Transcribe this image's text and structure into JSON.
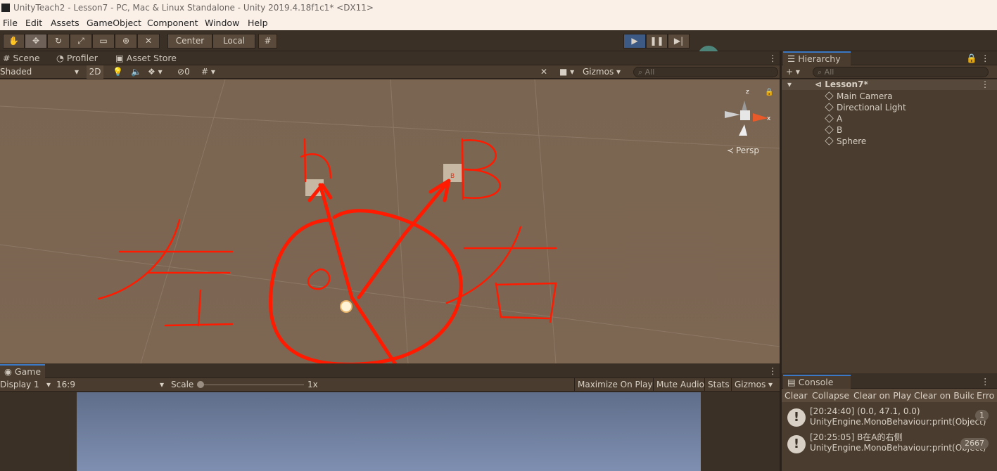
{
  "window": {
    "title": "UnityTeach2 - Lesson7 - PC, Mac & Linux Standalone - Unity 2019.4.18f1c1* <DX11>"
  },
  "menu": [
    "File",
    "Edit",
    "Assets",
    "GameObject",
    "Component",
    "Window",
    "Help"
  ],
  "toolbar": {
    "center_label": "Center",
    "local_label": "Local"
  },
  "scene": {
    "tabs": [
      "Scene",
      "Profiler",
      "Asset Store"
    ],
    "shading": "Shaded",
    "mode_2d": "2D",
    "fx_count": "0",
    "gizmos": "Gizmos",
    "search_placeholder": "All",
    "persp_label": "Persp",
    "axis_x": "x",
    "axis_z": "z",
    "object_b_label": "B"
  },
  "game": {
    "tab": "Game",
    "display": "Display 1",
    "aspect": "16:9",
    "scale_label": "Scale",
    "scale_value": "1x",
    "maximize": "Maximize On Play",
    "mute": "Mute Audio",
    "stats": "Stats",
    "gizmos": "Gizmos"
  },
  "hierarchy": {
    "tab": "Hierarchy",
    "search_placeholder": "All",
    "scene_name": "Lesson7*",
    "items": [
      "Main Camera",
      "Directional Light",
      "A",
      "B",
      "Sphere"
    ]
  },
  "console": {
    "tab": "Console",
    "buttons": [
      "Clear",
      "Collapse",
      "Clear on Play",
      "Clear on Build",
      "Erro"
    ],
    "logs": [
      {
        "line1": "[20:24:40] (0.0, 47.1, 0.0)",
        "line2": "UnityEngine.MonoBehaviour:print(Object)",
        "count": "1"
      },
      {
        "line1": "[20:25:05] B在A的右侧",
        "line2": "UnityEngine.MonoBehaviour:print(Object)",
        "count": "2667"
      }
    ]
  },
  "colors": {
    "play_button": "#3c5a84",
    "annotation": "#ff1a00",
    "scene_bg": "#7a6552",
    "game_sky_top": "#5f6e8a",
    "game_sky_bottom": "#7f8fb1"
  }
}
